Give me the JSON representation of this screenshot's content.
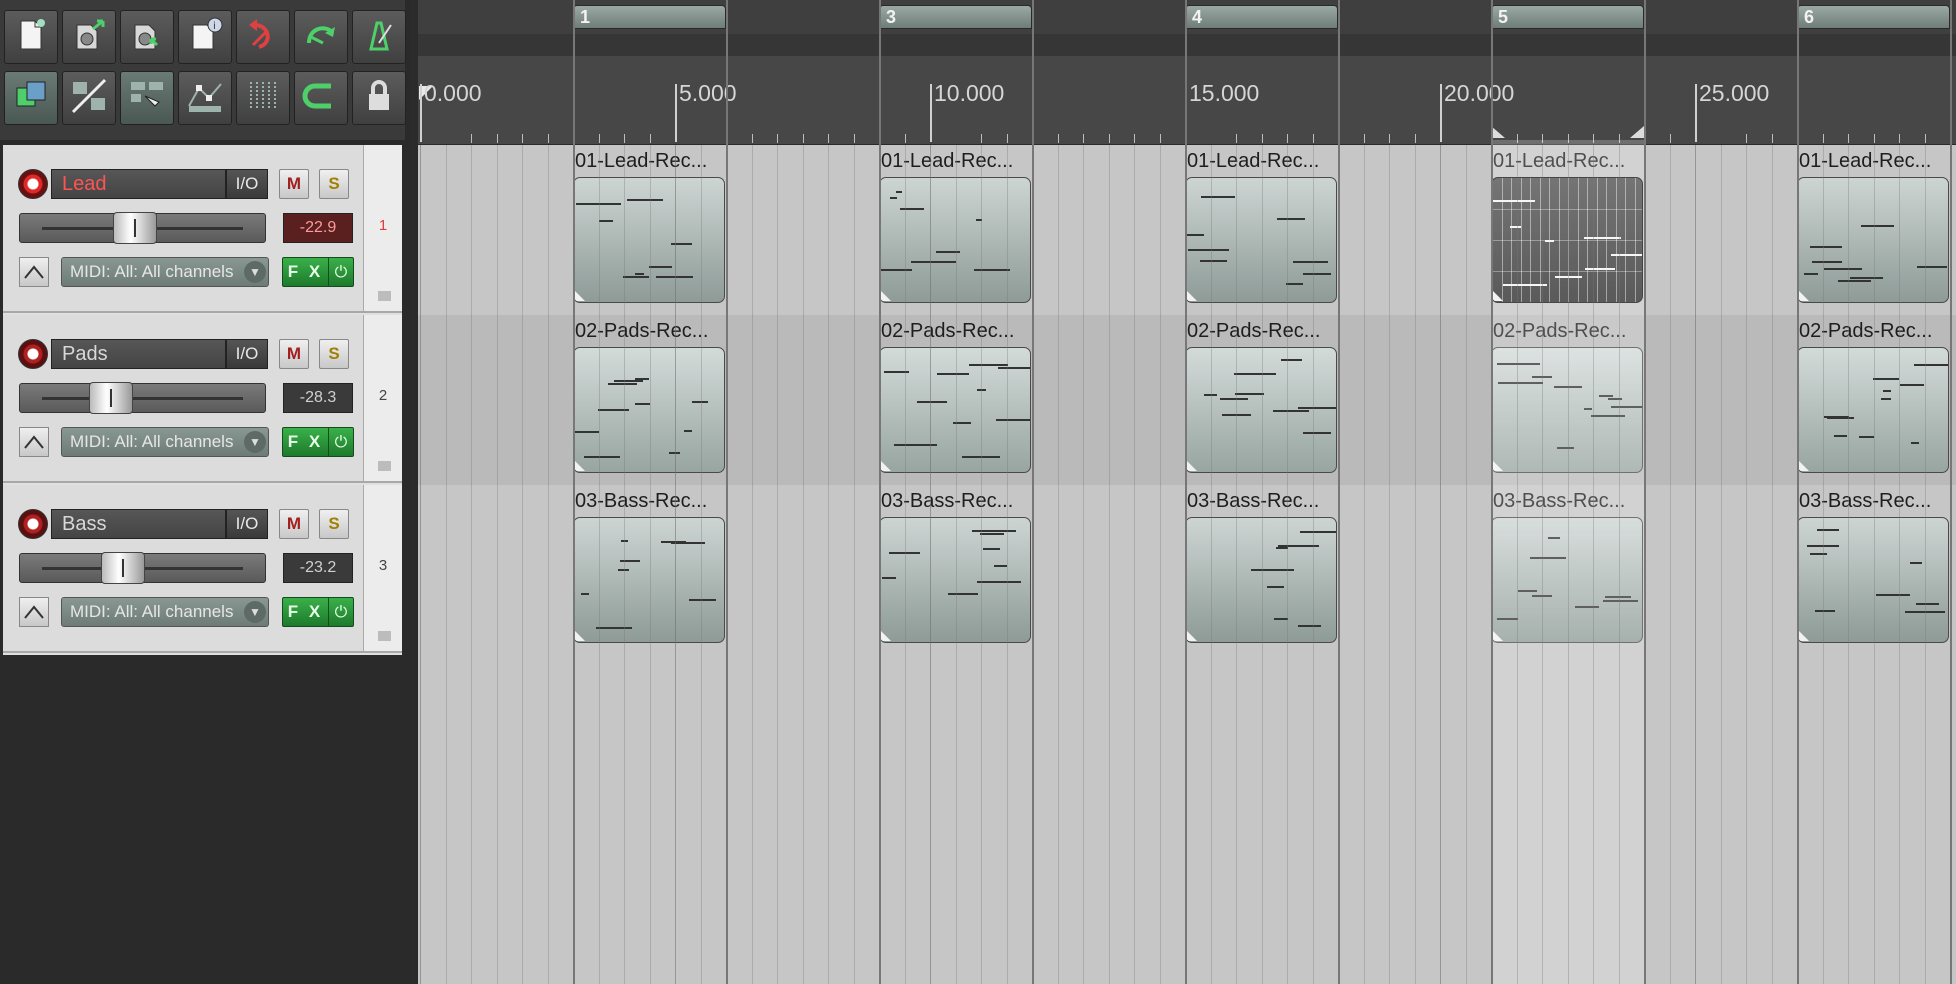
{
  "toolbar": {
    "row1": [
      {
        "icon": "new-project-icon"
      },
      {
        "icon": "open-project-icon"
      },
      {
        "icon": "save-project-icon"
      },
      {
        "icon": "project-settings-icon"
      },
      {
        "icon": "undo-icon"
      },
      {
        "icon": "redo-icon"
      },
      {
        "icon": "metronome-icon"
      }
    ],
    "row2": [
      {
        "icon": "auto-crossfade-icon",
        "on": true
      },
      {
        "icon": "ripple-edit-icon"
      },
      {
        "icon": "grouping-icon",
        "on": true
      },
      {
        "icon": "envelope-points-icon"
      },
      {
        "icon": "snap-grid-icon"
      },
      {
        "icon": "loop-icon"
      },
      {
        "icon": "lock-icon"
      }
    ]
  },
  "tracks": [
    {
      "name": "Lead",
      "io": "I/O",
      "mute": "M",
      "solo": "S",
      "volume_db": "-22.9",
      "fader_position": 0.46,
      "midi_input": "MIDI: All: All channels",
      "fx": "F X",
      "number": "1",
      "selected": true
    },
    {
      "name": "Pads",
      "io": "I/O",
      "mute": "M",
      "solo": "S",
      "volume_db": "-28.3",
      "fader_position": 0.34,
      "midi_input": "MIDI: All: All channels",
      "fx": "F X",
      "number": "2",
      "selected": false
    },
    {
      "name": "Bass",
      "io": "I/O",
      "mute": "M",
      "solo": "S",
      "volume_db": "-23.2",
      "fader_position": 0.4,
      "midi_input": "MIDI: All: All channels",
      "fx": "F X",
      "number": "3",
      "selected": false
    }
  ],
  "timeline": {
    "start_seconds": 0,
    "end_seconds": 29.3,
    "ruler_labels": [
      {
        "text": "0.000",
        "sec": 0
      },
      {
        "text": "5.000",
        "sec": 5
      },
      {
        "text": "10.000",
        "sec": 10
      },
      {
        "text": "15.000",
        "sec": 15
      },
      {
        "text": "20.000",
        "sec": 20
      },
      {
        "text": "25.000",
        "sec": 25
      }
    ],
    "regions": [
      {
        "label": "1",
        "start_sec": 3.0,
        "end_sec": 6.0
      },
      {
        "label": "3",
        "start_sec": 9.0,
        "end_sec": 12.0
      },
      {
        "label": "4",
        "start_sec": 15.0,
        "end_sec": 18.0
      },
      {
        "label": "5",
        "start_sec": 21.0,
        "end_sec": 24.0
      },
      {
        "label": "6",
        "start_sec": 27.0,
        "end_sec": 30.0
      }
    ],
    "time_selection": {
      "start_sec": 21.0,
      "end_sec": 24.0
    }
  },
  "items": [
    {
      "track": 0,
      "start_sec": 3.0,
      "title": "01-Lead-Rec...",
      "selected": false
    },
    {
      "track": 0,
      "start_sec": 9.0,
      "title": "01-Lead-Rec...",
      "selected": false
    },
    {
      "track": 0,
      "start_sec": 15.0,
      "title": "01-Lead-Rec...",
      "selected": false
    },
    {
      "track": 0,
      "start_sec": 21.0,
      "title": "01-Lead-Rec...",
      "selected": true
    },
    {
      "track": 0,
      "start_sec": 27.0,
      "title": "01-Lead-Rec...",
      "selected": false
    },
    {
      "track": 1,
      "start_sec": 3.0,
      "title": "02-Pads-Rec...",
      "selected": false
    },
    {
      "track": 1,
      "start_sec": 9.0,
      "title": "02-Pads-Rec...",
      "selected": false
    },
    {
      "track": 1,
      "start_sec": 15.0,
      "title": "02-Pads-Rec...",
      "selected": false
    },
    {
      "track": 1,
      "start_sec": 21.0,
      "title": "02-Pads-Rec...",
      "selected": false
    },
    {
      "track": 1,
      "start_sec": 27.0,
      "title": "02-Pads-Rec...",
      "selected": false
    },
    {
      "track": 2,
      "start_sec": 3.0,
      "title": "03-Bass-Rec...",
      "selected": false
    },
    {
      "track": 2,
      "start_sec": 9.0,
      "title": "03-Bass-Rec...",
      "selected": false
    },
    {
      "track": 2,
      "start_sec": 15.0,
      "title": "03-Bass-Rec...",
      "selected": false
    },
    {
      "track": 2,
      "start_sec": 21.0,
      "title": "03-Bass-Rec...",
      "selected": false
    },
    {
      "track": 2,
      "start_sec": 27.0,
      "title": "03-Bass-Rec...",
      "selected": false
    }
  ],
  "colors": {
    "selected_track_name": "#ff5454",
    "fx_enabled": "#2a9a3a",
    "item_body": "#a9b6b2",
    "selected_item": "#3a3a3a"
  }
}
